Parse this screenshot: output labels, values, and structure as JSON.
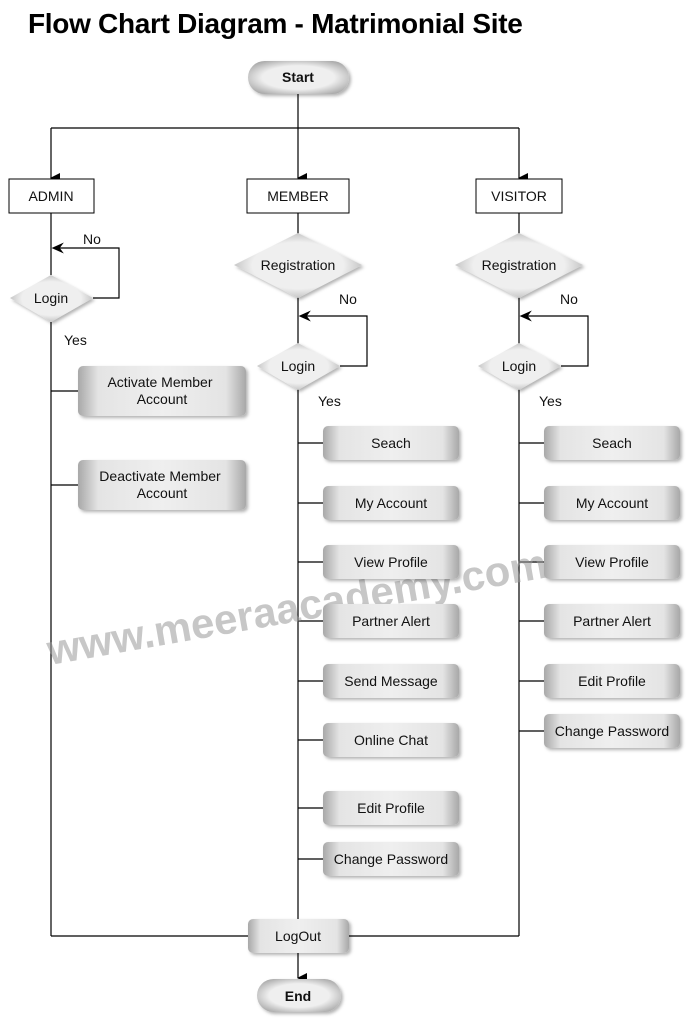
{
  "title": "Flow Chart Diagram - Matrimonial Site",
  "terminals": {
    "start": "Start",
    "end": "End"
  },
  "logout": "LogOut",
  "watermark": "www.meeraacademy.com",
  "decision_labels": {
    "no": "No",
    "yes": "Yes"
  },
  "lanes": {
    "admin": {
      "label": "ADMIN",
      "decisions": [
        "Login"
      ],
      "actions": [
        [
          "Activate Member",
          "Account"
        ],
        [
          "Deactivate Member",
          "Account"
        ]
      ]
    },
    "member": {
      "label": "MEMBER",
      "decisions": [
        "Registration",
        "Login"
      ],
      "actions": [
        "Seach",
        "My Account",
        "View Profile",
        "Partner Alert",
        "Send Message",
        "Online Chat",
        "Edit Profile",
        "Change Password"
      ]
    },
    "visitor": {
      "label": "VISITOR",
      "decisions": [
        "Registration",
        "Login"
      ],
      "actions": [
        "Seach",
        "My Account",
        "View Profile",
        "Partner Alert",
        "Edit Profile",
        "Change Password"
      ]
    }
  },
  "colors": {
    "line": "#000000",
    "shape_fill": "#e8e8e8",
    "shape_edge": "#9a9a9a",
    "watermark": "#9a9a9a"
  }
}
